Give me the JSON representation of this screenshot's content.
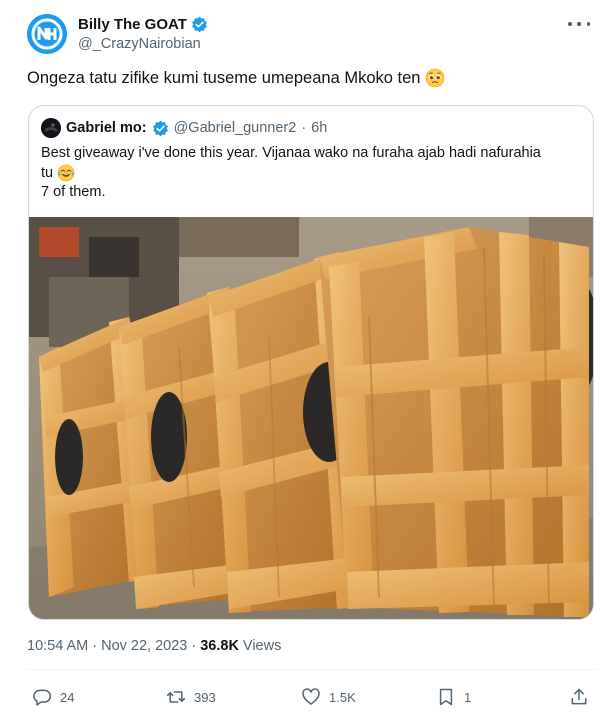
{
  "author": {
    "display_name": "Billy The GOAT",
    "handle": "@_CrazyNairobian",
    "verified": true
  },
  "tweet_text": "Ongeza tatu zifike kumi tuseme umepeana Mkoko ten",
  "quote": {
    "display_name": "Gabriel mo:",
    "handle": "@Gabriel_gunner2",
    "separator": "·",
    "age": "6h",
    "text_line1": "Best giveaway i've done this year. Vijanaa wako na furaha ajab hadi nafurahia",
    "text_line2": "tu",
    "text_line3": "7 of them."
  },
  "meta": {
    "time": "10:54 AM",
    "dot": "·",
    "date": "Nov 22, 2023",
    "dot2": "·",
    "views_count": "36.8K",
    "views_label": "Views"
  },
  "actions": {
    "replies": "24",
    "reposts": "393",
    "likes": "1.5K",
    "bookmarks": "1"
  },
  "colors": {
    "accent": "#1d9bf0",
    "text_primary": "#0f1419",
    "text_secondary": "#536471",
    "border": "#cfd9de"
  },
  "icons": {
    "verified": "verified-badge-icon",
    "more": "more-options-icon",
    "reply": "reply-icon",
    "repost": "repost-icon",
    "like": "heart-icon",
    "bookmark": "bookmark-icon",
    "share": "share-icon"
  }
}
